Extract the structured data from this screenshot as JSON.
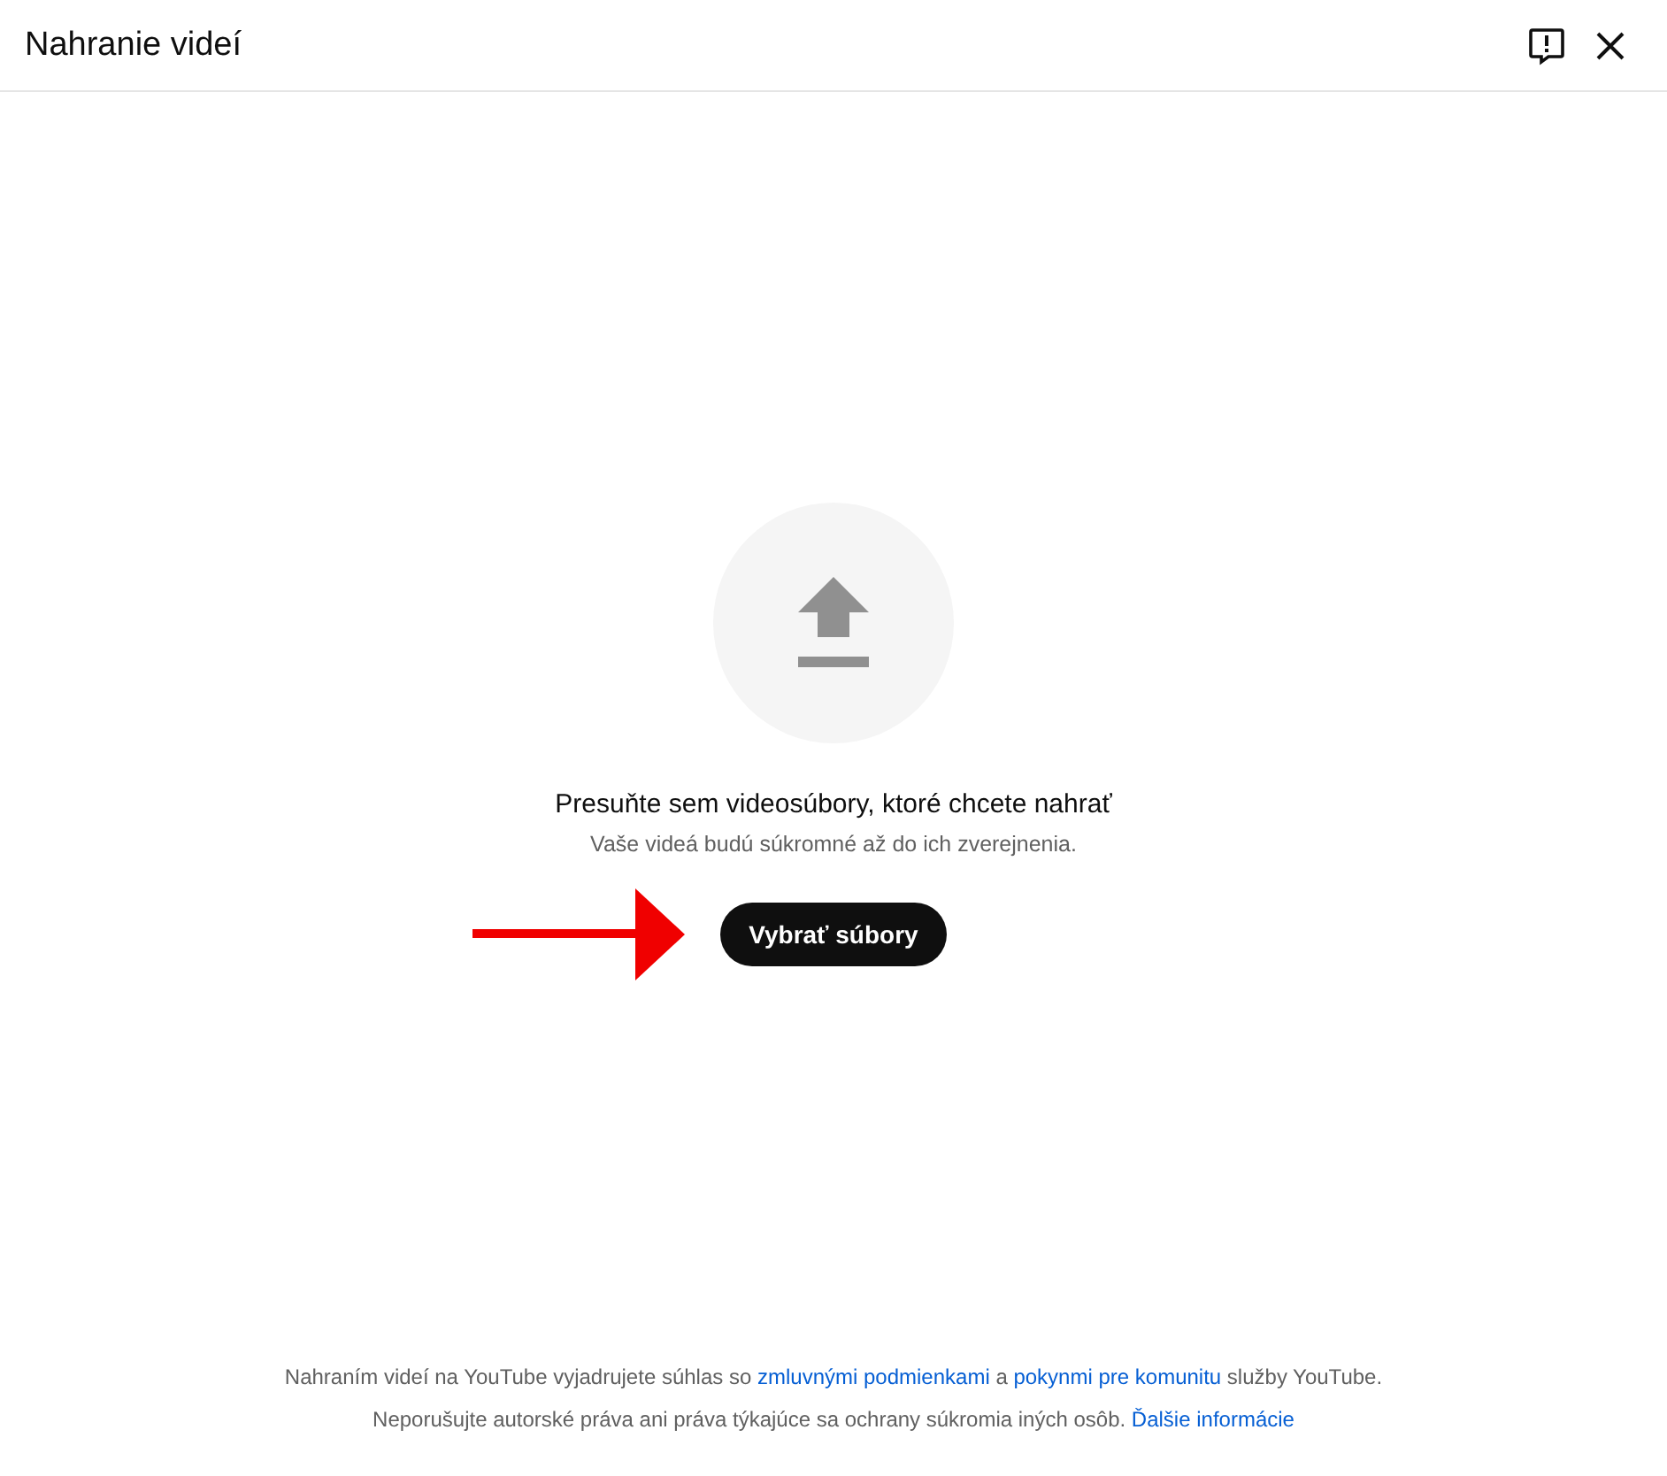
{
  "dialog": {
    "title": "Nahranie videí"
  },
  "upload": {
    "heading": "Presuňte sem videosúbory, ktoré chcete nahrať",
    "subtext": "Vaše videá budú súkromné až do ich zverejnenia.",
    "button": "Vybrať súbory"
  },
  "footer": [
    [
      {
        "kind": "text",
        "text": "Nahraním videí na YouTube vyjadrujete súhlas so "
      },
      {
        "kind": "link",
        "text": "zmluvnými podmienkami"
      },
      {
        "kind": "text",
        "text": " a "
      },
      {
        "kind": "link",
        "text": "pokynmi pre komunitu"
      },
      {
        "kind": "text",
        "text": " služby YouTube."
      }
    ],
    [
      {
        "kind": "text",
        "text": "Neporušujte autorské práva ani práva týkajúce sa ochrany súkromia iných osôb. "
      },
      {
        "kind": "link",
        "text": "Ďalšie informácie"
      }
    ]
  ]
}
